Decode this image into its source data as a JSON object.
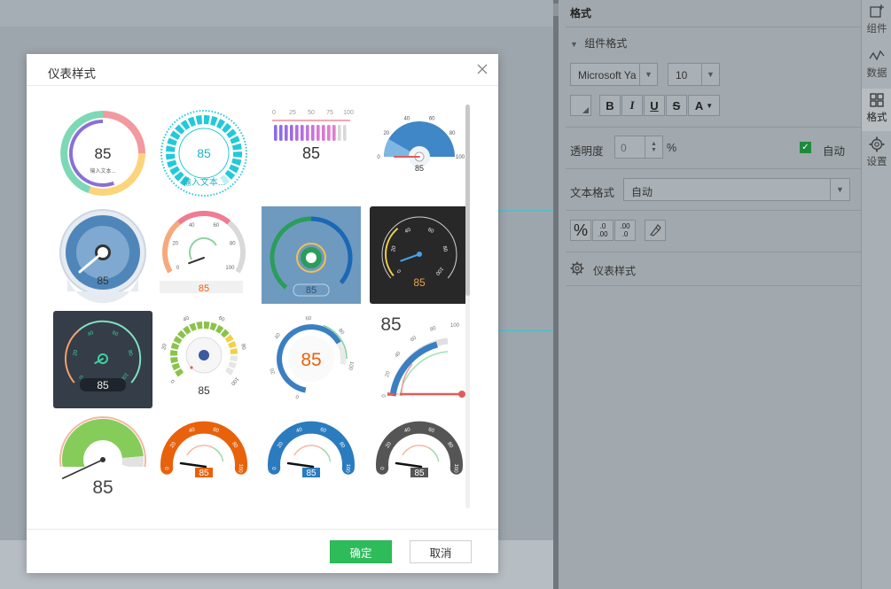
{
  "panel": {
    "title": "格式",
    "section_label": "组件格式",
    "font_family_value": "Microsoft Ya",
    "font_size_value": "10",
    "bold_label": "B",
    "italic_label": "I",
    "underline_label": "U",
    "strike_label": "S",
    "color_label": "A",
    "opacity_label": "透明度",
    "opacity_value": "0",
    "opacity_unit": "%",
    "auto_label": "自动",
    "text_format_label": "文本格式",
    "text_format_value": "自动",
    "percent_btn": "%",
    "dec_add_top": ".0",
    "dec_add_bot": ".00",
    "dec_del_top": ".00",
    "dec_del_bot": ".0",
    "gauge_style_label": "仪表样式"
  },
  "tabs": [
    {
      "label": "组件",
      "icon": "component-add-icon"
    },
    {
      "label": "数据",
      "icon": "data-line-icon"
    },
    {
      "label": "格式",
      "icon": "grid-format-icon"
    },
    {
      "label": "设置",
      "icon": "gear-icon"
    }
  ],
  "dialog": {
    "title": "仪表样式",
    "ok_label": "确定",
    "cancel_label": "取消",
    "gauges": [
      {
        "style": "ring",
        "value": "85",
        "caption": "输入文本..."
      },
      {
        "style": "segmented-ring",
        "value": "85",
        "caption": "输入文本..."
      },
      {
        "style": "bars",
        "value": "85",
        "ticks": [
          "0",
          "25",
          "50",
          "75",
          "100"
        ]
      },
      {
        "style": "semicircle-blue",
        "value": "85",
        "ticks": [
          "0",
          "20",
          "40",
          "60",
          "80",
          "100"
        ]
      },
      {
        "style": "dial-blue",
        "value": "85"
      },
      {
        "style": "dial-gradient",
        "value": "85",
        "ticks": [
          "0",
          "20",
          "40",
          "60",
          "80",
          "100"
        ]
      },
      {
        "style": "dial-dark-blue-bg",
        "value": "85"
      },
      {
        "style": "dial-black",
        "value": "85",
        "ticks": [
          "0",
          "20",
          "40",
          "60",
          "80",
          "100"
        ]
      },
      {
        "style": "dial-dark-neon",
        "value": "85",
        "ticks": [
          "0",
          "20",
          "40",
          "60",
          "80",
          "100"
        ]
      },
      {
        "style": "dial-green-yellow",
        "value": "85",
        "ticks": [
          "0",
          "20",
          "40",
          "60",
          "80",
          "100"
        ]
      },
      {
        "style": "dial-orange-number",
        "value": "85",
        "ticks": [
          "0",
          "20",
          "40",
          "60",
          "80",
          "100"
        ]
      },
      {
        "style": "quarter-arc",
        "value": "85",
        "ticks": [
          "0",
          "20",
          "40",
          "60",
          "80",
          "100"
        ]
      },
      {
        "style": "sector-green",
        "value": "85"
      },
      {
        "style": "arc-orange",
        "value": "85",
        "ticks": [
          "0",
          "20",
          "40",
          "60",
          "80",
          "100"
        ]
      },
      {
        "style": "arc-blue",
        "value": "85",
        "ticks": [
          "0",
          "20",
          "40",
          "60",
          "80",
          "100"
        ]
      },
      {
        "style": "arc-gray",
        "value": "85",
        "ticks": [
          "0",
          "20",
          "40",
          "60",
          "80",
          "100"
        ]
      }
    ]
  },
  "colors": {
    "accent_green": "#2ebc5b",
    "orange": "#e8620c",
    "blue": "#2b7bbf",
    "gray": "#555555"
  }
}
